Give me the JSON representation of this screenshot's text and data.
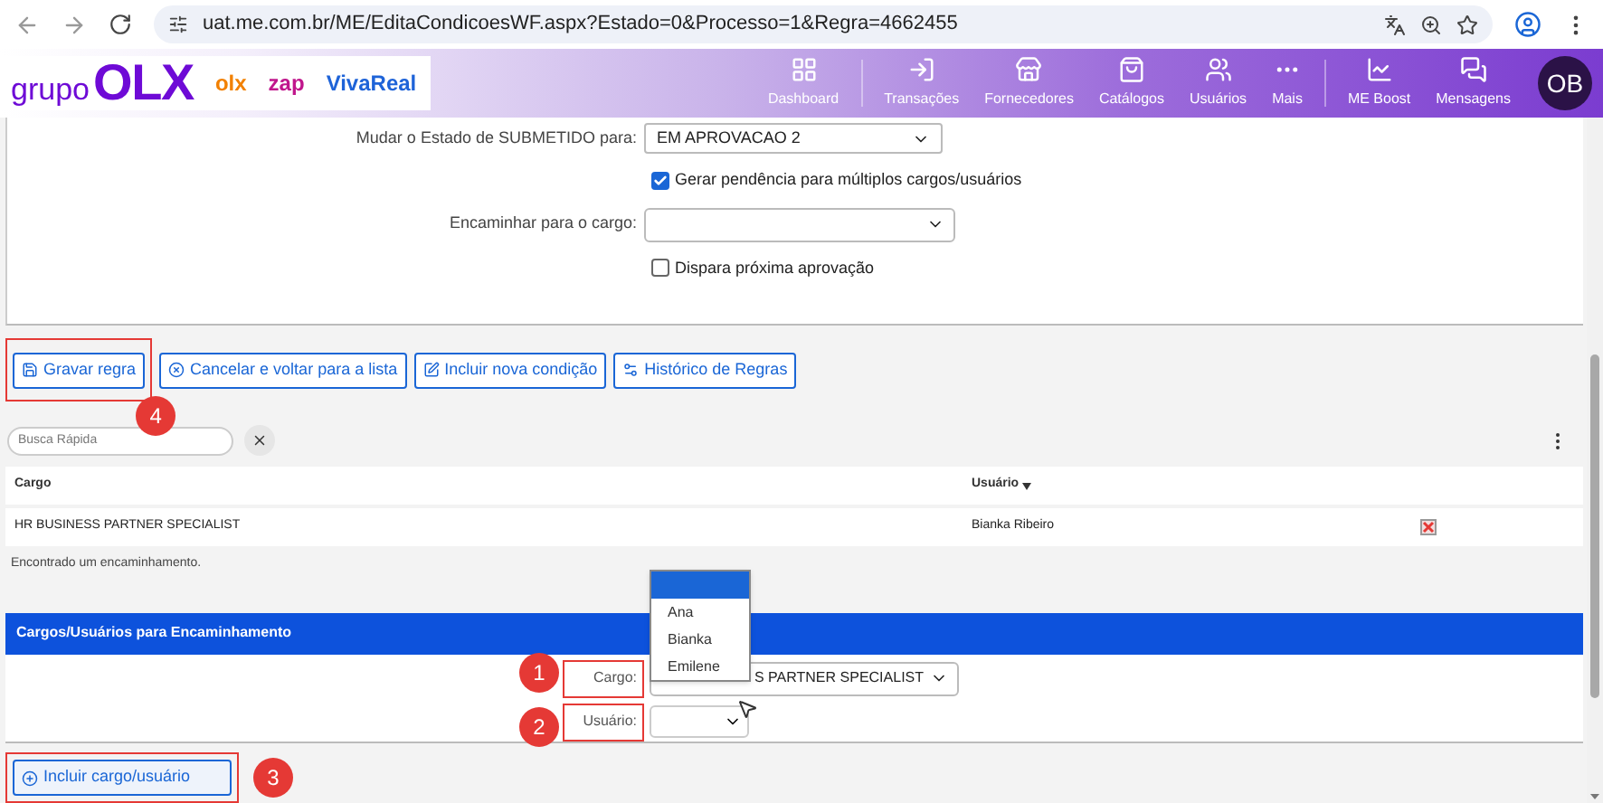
{
  "browser": {
    "url": "uat.me.com.br/ME/EditaCondicoesWF.aspx?Estado=0&Processo=1&Regra=4662455"
  },
  "header": {
    "logo": {
      "prefix": "grupo",
      "wordmark": "OLX"
    },
    "partner_logos": [
      {
        "label": "olx",
        "color": "#f28000"
      },
      {
        "label": "zap",
        "color": "#c0168c"
      },
      {
        "label": "VivaReal",
        "color": "#1e63d8"
      }
    ],
    "nav": [
      {
        "label": "Dashboard"
      },
      {
        "label": "Transações"
      },
      {
        "label": "Fornecedores"
      },
      {
        "label": "Catálogos"
      },
      {
        "label": "Usuários"
      },
      {
        "label": "Mais"
      },
      {
        "label": "ME Boost"
      },
      {
        "label": "Mensagens"
      }
    ],
    "avatar": "OB"
  },
  "form": {
    "state_label": "Mudar o Estado de SUBMETIDO para:",
    "state_value": "EM APROVACAO 2",
    "multi_checkbox": {
      "label": "Gerar pendência para múltiplos cargos/usuários",
      "checked": true
    },
    "forward_label": "Encaminhar para o cargo:",
    "next_checkbox": {
      "label": "Dispara próxima aprovação",
      "checked": false
    }
  },
  "actions": [
    {
      "label": "Gravar regra",
      "annotation": "4"
    },
    {
      "label": "Cancelar e voltar para a lista"
    },
    {
      "label": "Incluir nova condição"
    },
    {
      "label": "Histórico de Regras"
    }
  ],
  "search": {
    "placeholder": "Busca Rápida"
  },
  "table": {
    "columns": [
      {
        "label": "Cargo",
        "sorted": false
      },
      {
        "label": "Usuário",
        "sorted": true
      }
    ],
    "rows": [
      {
        "cargo": "HR BUSINESS PARTNER SPECIALIST",
        "usuario": "Bianka Ribeiro"
      }
    ],
    "footer": "Encontrado um encaminhamento."
  },
  "routing": {
    "title": "Cargos/Usuários para Encaminhamento",
    "cargo_label": "Cargo:",
    "cargo_annotation": "1",
    "cargo_value": "S PARTNER SPECIALIST",
    "user_label": "Usuário:",
    "user_annotation": "2",
    "options": [
      {
        "selected": true
      },
      {
        "label": "Ana",
        "selected": false
      },
      {
        "label": "Bianka",
        "selected": false
      },
      {
        "label": "Emilene",
        "selected": false
      }
    ]
  },
  "add_button": {
    "label": "Incluir cargo/usuário",
    "annotation": "3"
  }
}
